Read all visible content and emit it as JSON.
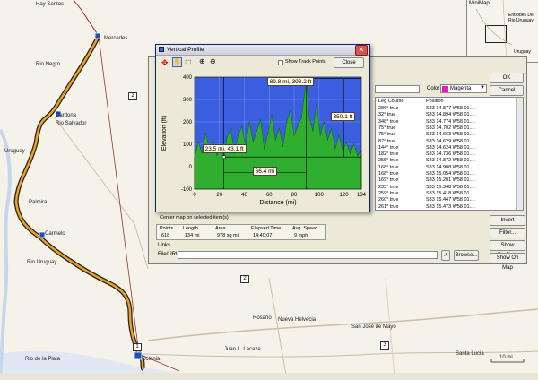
{
  "map": {
    "places": [
      "Hay Santos",
      "Mercedes",
      "Rio Negro",
      "Cardona",
      "Rio Salvador",
      "Uruguay",
      "Palmira",
      "Carmelo",
      "Rio Uruguay",
      "Rosario",
      "Nueva Helvecia",
      "San Jose de Mayo",
      "Juan L. Lacaze",
      "Santa Lucia",
      "Rio de la Plata",
      "Colonia"
    ],
    "shields": [
      "2",
      "2",
      "1",
      "3"
    ],
    "scale_label": "10 mi"
  },
  "minimap": {
    "title": "MiniMap",
    "places": [
      "Entrobes Del Rio Uruguay",
      "Uruguay"
    ]
  },
  "route_window": {
    "ok_label": "OK",
    "cancel_label": "Cancel",
    "color_label": "Color:",
    "color_value": "Magenta",
    "color_hex": "#e020c0",
    "columns": [
      "Leg Course",
      "Position"
    ],
    "rows": [
      [
        "286° true",
        "S33 14.877 W58 01...."
      ],
      [
        "32° true",
        "S33 14.894 W58 01...."
      ],
      [
        "348° true",
        "S33 14.774 W58 01...."
      ],
      [
        "75° true",
        "S33 14.702 W58 01...."
      ],
      [
        "75° true",
        "S33 14.663 W58 01...."
      ],
      [
        "87° true",
        "S33 14.629 W58 01...."
      ],
      [
        "144° true",
        "S33 14.624 W58 01...."
      ],
      [
        "182° true",
        "S33 14.736 W58 01...."
      ],
      [
        "255° true",
        "S33 14.872 W58 01...."
      ],
      [
        "168° true",
        "S33 14.908 W58 01...."
      ],
      [
        "168° true",
        "S33 15.054 W58 01...."
      ],
      [
        "169° true",
        "S33 15.201 W58 01...."
      ],
      [
        "233° true",
        "S33 15.348 W58 01...."
      ],
      [
        "259° true",
        "S33 15.418 W58 01...."
      ],
      [
        "260° true",
        "S33 15.447 W58 01...."
      ],
      [
        "261° true",
        "S33 15.473 W58 01...."
      ]
    ],
    "center_map_label": "Center map on selected item(s)",
    "stats_headers": [
      "Points",
      "Length",
      "Area",
      "Elapsed Time",
      "Avg. Speed"
    ],
    "stats_values": [
      "618",
      "134 mi",
      "978 sq mi",
      "14:40:07",
      "9 mph"
    ],
    "links_label": "Links",
    "file_url_label": "File/URL:",
    "file_url_value": "",
    "browse_label": "Browse...",
    "invert_label": "Invert",
    "filter_label": "Filter...",
    "show_profile_label": "Show Profile...",
    "show_on_map_label": "Show On Map"
  },
  "profile_window": {
    "title": "Vertical Profile",
    "show_track_points_label": "Show Track Points",
    "close_label": "Close",
    "tools": [
      "crosshair-icon",
      "hand-icon",
      "select-icon",
      "zoom-in-icon",
      "zoom-out-icon"
    ],
    "colors": {
      "fill": "#2fae2f",
      "stroke": "#136d13",
      "background": "#3b5ee0"
    }
  },
  "chart_data": {
    "type": "area",
    "xlabel": "Distance   (mi)",
    "ylabel": "Elevation (ft)",
    "xlim": [
      0,
      134
    ],
    "ylim": [
      -100,
      400
    ],
    "xticks": [
      0,
      20,
      40,
      60,
      80,
      100,
      120,
      134
    ],
    "yticks": [
      -100,
      0,
      100,
      200,
      300,
      400
    ],
    "grid": true,
    "series": [
      {
        "x": [
          0,
          3,
          6,
          9,
          12,
          15,
          18,
          21,
          23.5,
          26,
          29,
          32,
          35,
          38,
          41,
          44,
          47,
          50,
          53,
          56,
          59,
          62,
          65,
          68,
          71,
          74,
          77,
          80,
          83,
          86,
          89.8,
          92,
          95,
          98,
          101,
          104,
          107,
          110,
          113,
          116,
          119,
          122,
          125,
          128,
          131,
          134
        ],
        "values": [
          40,
          110,
          60,
          150,
          70,
          120,
          50,
          90,
          43,
          130,
          170,
          60,
          140,
          180,
          90,
          200,
          110,
          160,
          210,
          80,
          150,
          230,
          120,
          170,
          90,
          200,
          250,
          140,
          180,
          220,
          393,
          220,
          160,
          280,
          140,
          200,
          120,
          170,
          80,
          140,
          70,
          110,
          60,
          100,
          50,
          70
        ]
      }
    ],
    "annotations": [
      {
        "text": "23.5 mi, 43.1 ft"
      },
      {
        "text": "89.8 mi, 393.2 ft"
      },
      {
        "text": "66.4 mi"
      },
      {
        "text": "350.1 ft"
      }
    ]
  }
}
